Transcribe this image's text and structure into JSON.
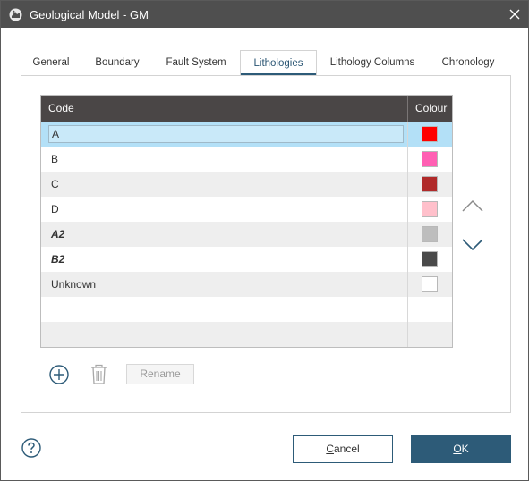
{
  "window": {
    "title": "Geological Model - GM"
  },
  "tabs": [
    {
      "label": "General"
    },
    {
      "label": "Boundary"
    },
    {
      "label": "Fault System"
    },
    {
      "label": "Lithologies",
      "active": true
    },
    {
      "label": "Lithology Columns"
    },
    {
      "label": "Chronology"
    }
  ],
  "table": {
    "headers": {
      "code": "Code",
      "colour": "Colour"
    },
    "rows": [
      {
        "code": "A",
        "colour": "#ff0000",
        "selected": true,
        "editing": true
      },
      {
        "code": "B",
        "colour": "#ff5fb3"
      },
      {
        "code": "C",
        "colour": "#b02a2a"
      },
      {
        "code": "D",
        "colour": "#ffc0cb"
      },
      {
        "code": "A2",
        "colour": "#bdbdbd",
        "emphasis": "bold-italic"
      },
      {
        "code": "B2",
        "colour": "#4a4a4a",
        "emphasis": "bold-italic"
      },
      {
        "code": "Unknown",
        "colour": "#ffffff"
      }
    ]
  },
  "controls": {
    "move_up_icon": "chevron-up-icon",
    "move_down_icon": "chevron-down-icon",
    "add_icon": "plus-circle-icon",
    "delete_icon": "trash-icon",
    "rename_label": "Rename"
  },
  "footer": {
    "help_icon": "question-circle-icon",
    "cancel_label": "Cancel",
    "ok_label": "OK"
  },
  "colors": {
    "titlebar": "#4f4f4f",
    "accent": "#2d5b78",
    "header_bg": "#4a4646",
    "selected_row": "#b3e0f7"
  }
}
